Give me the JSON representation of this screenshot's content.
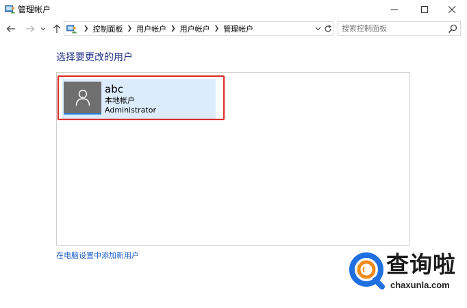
{
  "window": {
    "title": "管理帐户",
    "icons": {
      "app": "control-panel-users-icon",
      "minimize": "minimize-icon",
      "maximize": "maximize-icon",
      "close": "close-icon"
    }
  },
  "nav": {
    "icons": {
      "back": "arrow-left-icon",
      "forward": "arrow-right-icon",
      "recent": "chevron-down-icon",
      "up": "arrow-up-icon"
    }
  },
  "address": {
    "breadcrumbs": [
      "控制面板",
      "用户帐户",
      "用户帐户",
      "管理帐户"
    ],
    "icons": {
      "location": "user-accounts-icon",
      "separator": "chevron-right-icon",
      "dropdown": "chevron-down-icon",
      "refresh": "refresh-icon"
    }
  },
  "search": {
    "placeholder": "搜索控制面板",
    "value": "",
    "icon": "search-icon"
  },
  "main": {
    "heading": "选择要更改的用户",
    "users": [
      {
        "name": "abc",
        "type": "本地帐户",
        "role": "Administrator",
        "avatar_icon": "user-avatar-icon"
      }
    ],
    "add_user_link": "在电脑设置中添加新用户",
    "highlight_color": "#d9302c",
    "tile_color": "#dcecfc"
  },
  "watermark": {
    "brand": "查询啦",
    "url": "chaxunla.com",
    "colors": {
      "blue": "#1f6fe0",
      "orange": "#f08a1c"
    }
  }
}
